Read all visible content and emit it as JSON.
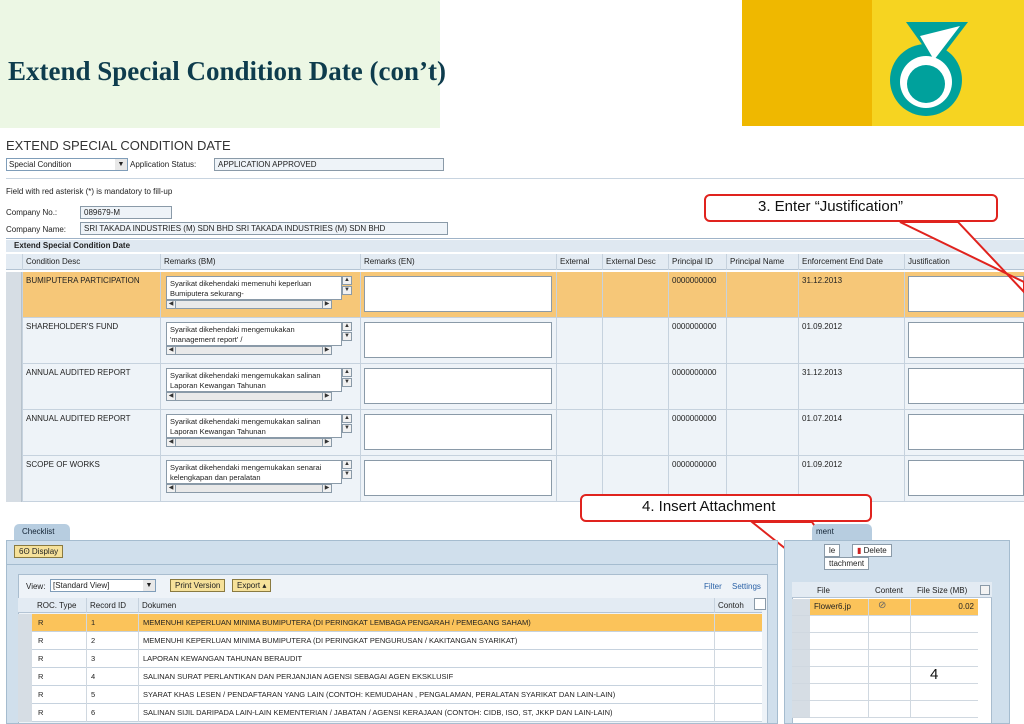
{
  "slide": {
    "title": "Extend Special Condition Date (con’t)",
    "page_number": "4",
    "colors": {
      "title": "#0e3c4d",
      "brand_green": "#00a19c",
      "brand_yellow": "#f6d421",
      "callout_red": "#e0231e"
    }
  },
  "screen": {
    "title": "EXTEND SPECIAL CONDITION DATE",
    "special_condition_select": "Special Condition",
    "application_status_label": "Application Status:",
    "application_status_value": "APPLICATION APPROVED",
    "mandatory_note": "Field with red asterisk (*) is mandatory to fill-up",
    "company_no_label": "Company No.:",
    "company_no_value": "089679-M",
    "company_name_label": "Company Name:",
    "company_name_value": "SRI TAKADA INDUSTRIES (M) SDN BHD SRI TAKADA INDUSTRIES (M) SDN BHD"
  },
  "grid": {
    "caption": "Extend Special Condition Date",
    "columns": [
      "Condition Desc",
      "Remarks (BM)",
      "Remarks (EN)",
      "External",
      "External Desc",
      "Principal ID",
      "Principal Name",
      "Enforcement End Date",
      "Justification"
    ],
    "rows": [
      {
        "condition": "BUMIPUTERA PARTICIPATION",
        "remarks_bm": "Syarikat dikehendaki memenuhi keperluan Bumiputera sekurang-",
        "principal_id": "0000000000",
        "end_date": "31.12.2013"
      },
      {
        "condition": "SHAREHOLDER'S FUND",
        "remarks_bm": "Syarikat dikehendaki mengemukakan 'management report' /",
        "principal_id": "0000000000",
        "end_date": "01.09.2012"
      },
      {
        "condition": "ANNUAL AUDITED REPORT",
        "remarks_bm": "Syarikat dikehendaki mengemukakan salinan Laporan Kewangan Tahunan",
        "principal_id": "0000000000",
        "end_date": "31.12.2013"
      },
      {
        "condition": "ANNUAL AUDITED REPORT",
        "remarks_bm": "Syarikat dikehendaki mengemukakan salinan Laporan Kewangan Tahunan",
        "principal_id": "0000000000",
        "end_date": "01.07.2014"
      },
      {
        "condition": "SCOPE OF WORKS",
        "remarks_bm": "Syarikat dikehendaki mengemukakan senarai kelengkapan dan peralatan",
        "principal_id": "0000000000",
        "end_date": "01.09.2012"
      }
    ]
  },
  "callouts": {
    "justification": "3.    Enter “Justification”",
    "attachment": "4.    Insert Attachment"
  },
  "checklist": {
    "tab": "Checklist",
    "display_button": "Display",
    "view_label": "View:",
    "view_value": "[Standard View]",
    "print_button": "Print Version",
    "export_button": "Export ▴",
    "filter_link": "Filter",
    "settings_link": "Settings",
    "columns": [
      "ROC. Type",
      "Record ID",
      "Dokumen",
      "Contoh"
    ],
    "rows": [
      {
        "type": "R",
        "id": "1",
        "doc": "MEMENUHI KEPERLUAN MINIMA BUMIPUTERA (DI PERINGKAT LEMBAGA PENGARAH / PEMEGANG SAHAM)"
      },
      {
        "type": "R",
        "id": "2",
        "doc": "MEMENUHI KEPERLUAN MINIMA BUMIPUTERA (DI PERINGKAT PENGURUSAN / KAKITANGAN SYARIKAT)"
      },
      {
        "type": "R",
        "id": "3",
        "doc": "LAPORAN KEWANGAN TAHUNAN BERAUDIT"
      },
      {
        "type": "R",
        "id": "4",
        "doc": "SALINAN SURAT PERLANTIKAN DAN PERJANJIAN AGENSI SEBAGAI AGEN EKSKLUSIF"
      },
      {
        "type": "R",
        "id": "5",
        "doc": "SYARAT KHAS LESEN / PENDAFTARAN YANG LAIN (CONTOH: KEMUDAHAN , PENGALAMAN, PERALATAN SYARIKAT DAN LAIN-LAIN)"
      },
      {
        "type": "R",
        "id": "6",
        "doc": "SALINAN SIJIL DARIPADA LAIN-LAIN KEMENTERIAN / JABATAN / AGENSI KERAJAAN (CONTOH: CIDB, ISO, ST, JKKP DAN LAIN-LAIN)"
      }
    ]
  },
  "attachment": {
    "tab": "ment",
    "file_button": "le",
    "delete_button": "Delete",
    "attachment_button": "ttachment",
    "columns": [
      "File",
      "Content",
      "File Size (MB)"
    ],
    "rows": [
      {
        "file": "Flower6.jp",
        "size": "0.02"
      }
    ]
  }
}
